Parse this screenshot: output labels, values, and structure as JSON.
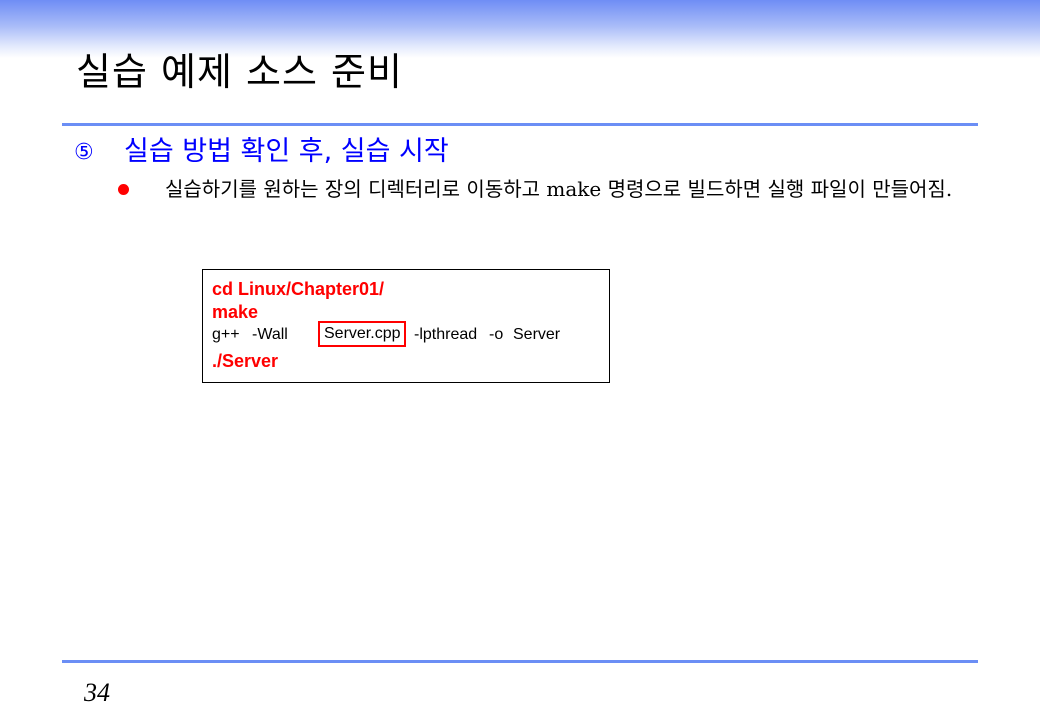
{
  "slide": {
    "title": "실습 예제 소스 준비",
    "accent_color": "#6b8ef5",
    "page_number": "34"
  },
  "step": {
    "number": "⑤",
    "title": "실습 방법 확인 후, 실습 시작",
    "color": "#0000ff"
  },
  "bullet": {
    "text": "실습하기를 원하는 장의 디렉터리로 이동하고 make 명령으로 빌드하면 실행 파일이 만들어짐.",
    "dot_color": "#ff0000"
  },
  "code": {
    "line1": "cd Linux/Chapter01/",
    "line2": "make",
    "line3": {
      "compiler": "g++",
      "flag_wall": "-Wall",
      "source": "Server.cpp",
      "flag_lpthread": "-lpthread",
      "flag_o": "-o",
      "output": "Server"
    },
    "line4": "./Server",
    "highlight_color": "#ff0000"
  }
}
